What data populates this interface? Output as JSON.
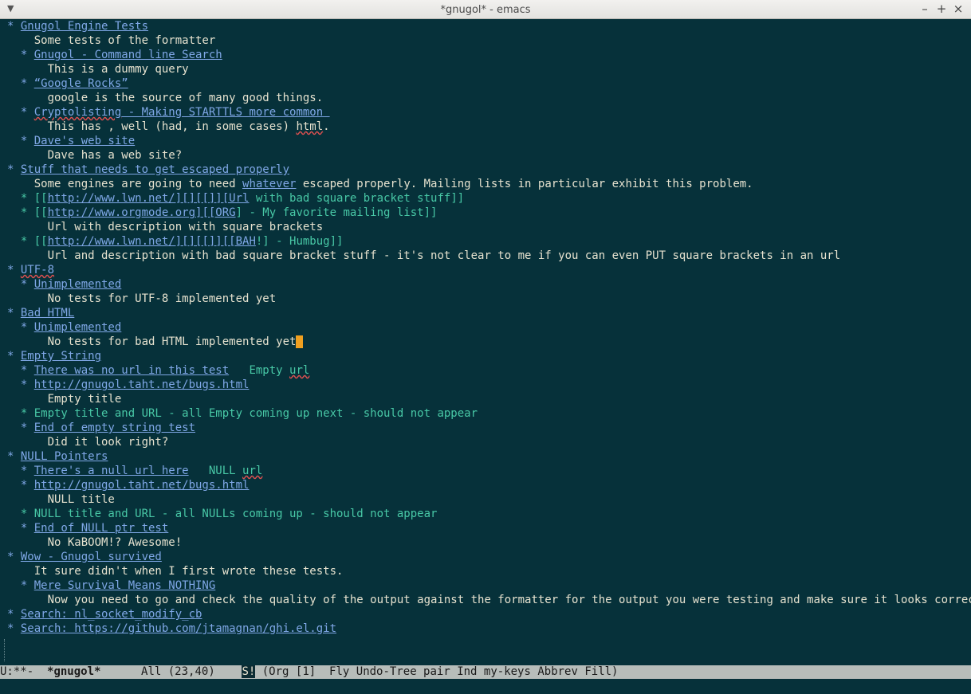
{
  "window": {
    "title": "*gnugol* - emacs",
    "menu_icon": "chevron-down-icon",
    "minimize": "–",
    "maximize": "+",
    "close": "×"
  },
  "buffer": [
    [
      {
        "t": "* ",
        "c": "l1"
      },
      {
        "t": "Gnugol Engine Tests",
        "c": "l1 u"
      }
    ],
    [
      {
        "t": "    Some tests of the formatter",
        "c": "body"
      }
    ],
    [
      {
        "t": "  * ",
        "c": "l2"
      },
      {
        "t": "Gnugol - Command line Search",
        "c": "l2 u"
      }
    ],
    [
      {
        "t": "      This is a dummy query",
        "c": "body"
      }
    ],
    [
      {
        "t": "  * ",
        "c": "l2"
      },
      {
        "t": "“Google Rocks”",
        "c": "l2 u"
      }
    ],
    [
      {
        "t": "      google is the source of many good things.",
        "c": "body"
      }
    ],
    [
      {
        "t": "  * ",
        "c": "l2"
      },
      {
        "t": "Cryptolisting",
        "c": "l2 u spell"
      },
      {
        "t": " - Making STARTTLS more common ",
        "c": "l2 u"
      }
    ],
    [
      {
        "t": "      This has , well (had, in some cases) ",
        "c": "body"
      },
      {
        "t": "html",
        "c": "body spell"
      },
      {
        "t": ".",
        "c": "body"
      }
    ],
    [
      {
        "t": "  * ",
        "c": "l2"
      },
      {
        "t": "Dave's web site",
        "c": "l2 u"
      }
    ],
    [
      {
        "t": "      Dave has a web site?",
        "c": "body"
      }
    ],
    [
      {
        "t": "* ",
        "c": "l1"
      },
      {
        "t": "Stuff that needs to get escaped properly",
        "c": "l1 u"
      }
    ],
    [
      {
        "t": "    Some engines are going to need ",
        "c": "body"
      },
      {
        "t": "whatever",
        "c": "link"
      },
      {
        "t": " escaped properly. Mailing lists in particular exhibit this problem.",
        "c": "body"
      }
    ],
    [
      {
        "t": "  * [[",
        "c": "grn"
      },
      {
        "t": "http://www.lwn.net/][][[]][Url",
        "c": "link"
      },
      {
        "t": " with bad square bracket stuff]]",
        "c": "grn"
      }
    ],
    [
      {
        "t": "  * [[",
        "c": "grn"
      },
      {
        "t": "http://www.orgmode.org][[ORG",
        "c": "link"
      },
      {
        "t": "] - My favorite mailing list]]",
        "c": "grn"
      }
    ],
    [
      {
        "t": "      Url with description with square brackets",
        "c": "body"
      }
    ],
    [
      {
        "t": "  * [[",
        "c": "grn"
      },
      {
        "t": "http://www.lwn.net/][][[]][[BAH",
        "c": "link"
      },
      {
        "t": "!] - Humbug]]",
        "c": "grn"
      }
    ],
    [
      {
        "t": "      Url and description with bad square bracket stuff - it's not clear to me if you can even PUT square brackets in an url",
        "c": "body"
      }
    ],
    [
      {
        "t": "* ",
        "c": "l1"
      },
      {
        "t": "UTF-8",
        "c": "l1 u spell"
      }
    ],
    [
      {
        "t": "  * ",
        "c": "l2"
      },
      {
        "t": "Unimplemented",
        "c": "l2 u"
      }
    ],
    [
      {
        "t": "      No tests for UTF-8 implemented yet",
        "c": "body"
      }
    ],
    [
      {
        "t": "* ",
        "c": "l1"
      },
      {
        "t": "Bad HTML",
        "c": "l1 u"
      }
    ],
    [
      {
        "t": "  * ",
        "c": "l2"
      },
      {
        "t": "Unimplemented",
        "c": "l2 u"
      }
    ],
    [
      {
        "t": "      No tests for bad HTML implemented yet",
        "c": "body"
      },
      {
        "t": " ",
        "c": "cursor"
      }
    ],
    [
      {
        "t": "* ",
        "c": "l1"
      },
      {
        "t": "Empty String",
        "c": "l1 u"
      }
    ],
    [
      {
        "t": "  * ",
        "c": "l2"
      },
      {
        "t": "There was no url in this test",
        "c": "l2 u"
      },
      {
        "t": "   Empty ",
        "c": "grn"
      },
      {
        "t": "url",
        "c": "grn spell"
      }
    ],
    [
      {
        "t": "  * ",
        "c": "l2"
      },
      {
        "t": "http://gnugol.taht.net/bugs.html",
        "c": "l2 u"
      }
    ],
    [
      {
        "t": "      Empty title",
        "c": "body"
      }
    ],
    [
      {
        "t": "  * Empty title and URL - all Empty coming up next - should not appear",
        "c": "grn"
      }
    ],
    [
      {
        "t": "  * ",
        "c": "l2"
      },
      {
        "t": "End of empty string test",
        "c": "l2 u"
      }
    ],
    [
      {
        "t": "      Did it look right?",
        "c": "body"
      }
    ],
    [
      {
        "t": "* ",
        "c": "l1"
      },
      {
        "t": "NULL Pointers",
        "c": "l1 u"
      }
    ],
    [
      {
        "t": "  * ",
        "c": "l2"
      },
      {
        "t": "There's a null url here",
        "c": "l2 u"
      },
      {
        "t": "   NULL ",
        "c": "grn"
      },
      {
        "t": "url",
        "c": "grn spell"
      }
    ],
    [
      {
        "t": "  * ",
        "c": "l2"
      },
      {
        "t": "http://gnugol.taht.net/bugs.html",
        "c": "l2 u"
      }
    ],
    [
      {
        "t": "      NULL title",
        "c": "body"
      }
    ],
    [
      {
        "t": "  * NULL title and URL - all NULLs coming up - should not appear",
        "c": "grn"
      }
    ],
    [
      {
        "t": "  * ",
        "c": "l2"
      },
      {
        "t": "End of NULL ptr test",
        "c": "l2 u"
      }
    ],
    [
      {
        "t": "      No KaBOOM!? Awesome!",
        "c": "body"
      }
    ],
    [
      {
        "t": "* ",
        "c": "l1"
      },
      {
        "t": "Wow - Gnugol survived",
        "c": "l1 u"
      }
    ],
    [
      {
        "t": "    It sure didn't when I first wrote these tests.",
        "c": "body"
      }
    ],
    [
      {
        "t": "  * ",
        "c": "l2"
      },
      {
        "t": "Mere Survival Means NOTHING",
        "c": "l2 u"
      }
    ],
    [
      {
        "t": "      Now you need to go and check the quality of the output against the formatter for the output you were testing and make sure it looks correct.",
        "c": "body"
      }
    ],
    [
      {
        "t": "* ",
        "c": "l1"
      },
      {
        "t": "Search: nl_socket_modify_cb",
        "c": "l1 u"
      }
    ],
    [
      {
        "t": "* ",
        "c": "l1"
      },
      {
        "t": "Search: https://github.com/jtamagnan/ghi.el.git",
        "c": "l1 u"
      }
    ]
  ],
  "modeline": {
    "state": "U:**-  ",
    "buffer_name": "*gnugol*",
    "position": "      All (23,40)    ",
    "s_indicator": "S!",
    "modes": " (Org [1]  Fly Undo-Tree pair Ind my-keys Abbrev Fill)"
  },
  "colors": {
    "background": "#06313a",
    "heading": "#7fa7e6",
    "body": "#e6e2cf",
    "green": "#48c8a6",
    "cursor": "#f0a020",
    "modeline": "#b7bdba"
  }
}
